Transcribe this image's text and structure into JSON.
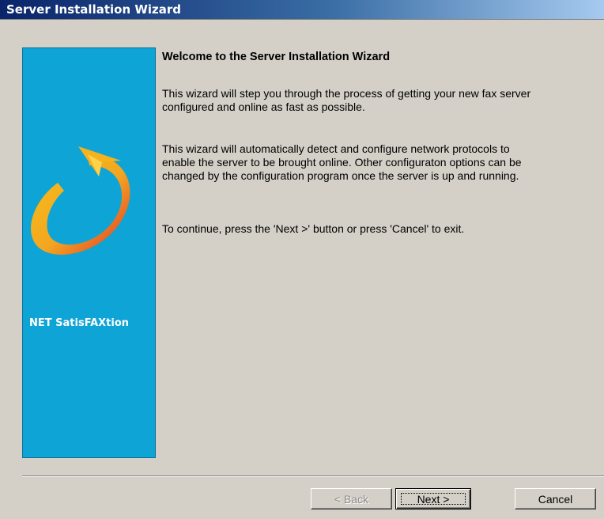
{
  "window": {
    "title": "Server Installation Wizard"
  },
  "banner": {
    "brand": "NET SatisFAXtion",
    "logo_icon": "circular-arrow-icon"
  },
  "content": {
    "heading": "Welcome to the Server Installation Wizard",
    "paragraphs": [
      [
        "This wizard will step you through the process of getting your new fax server",
        "configured and online as fast as possible."
      ],
      [
        "This wizard will automatically detect and configure network protocols to",
        "enable the server to be brought online. Other configuraton options can be",
        "changed by the configuration program once the server is up and running."
      ],
      [
        "To continue, press the 'Next >' button or press 'Cancel' to exit."
      ]
    ]
  },
  "buttons": {
    "back": "< Back",
    "next": "Next >",
    "cancel": "Cancel"
  },
  "colors": {
    "titlebar_start": "#0a246a",
    "banner_bg": "#0ea4d6",
    "dialog_bg": "#d4d0c8"
  }
}
